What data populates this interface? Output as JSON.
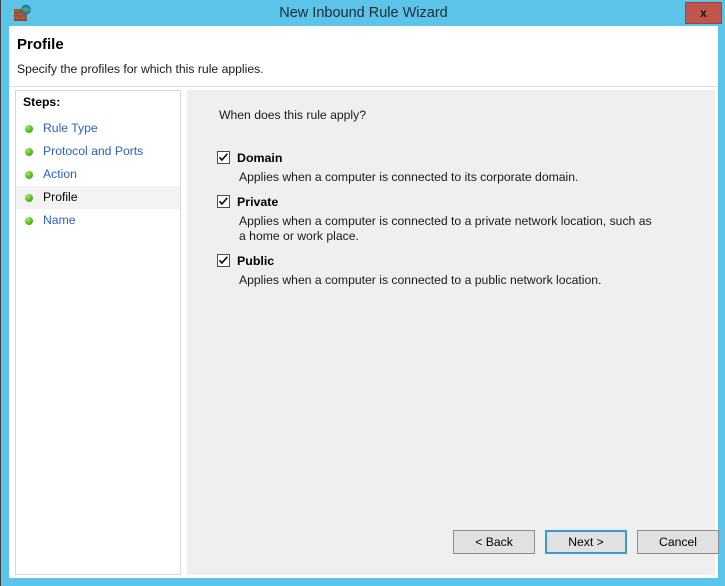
{
  "window": {
    "title": "New Inbound Rule Wizard",
    "icon": "firewall-globe-icon",
    "close_label": "x",
    "accent_color": "#5bc4e8",
    "close_button_color": "#c0554c"
  },
  "header": {
    "title": "Profile",
    "subtitle": "Specify the profiles for which this rule applies."
  },
  "sidebar": {
    "heading": "Steps:",
    "items": [
      {
        "label": "Rule Type",
        "current": false
      },
      {
        "label": "Protocol and Ports",
        "current": false
      },
      {
        "label": "Action",
        "current": false
      },
      {
        "label": "Profile",
        "current": true
      },
      {
        "label": "Name",
        "current": false
      }
    ]
  },
  "main": {
    "question": "When does this rule apply?",
    "profiles": [
      {
        "name": "Domain",
        "checked": true,
        "description": "Applies when a computer is connected to its corporate domain."
      },
      {
        "name": "Private",
        "checked": true,
        "description": "Applies when a computer is connected to a private network location, such as a home or work place."
      },
      {
        "name": "Public",
        "checked": true,
        "description": "Applies when a computer is connected to a public network location."
      }
    ]
  },
  "footer": {
    "back_label": "< Back",
    "next_label": "Next >",
    "cancel_label": "Cancel",
    "default_button": "Next >"
  }
}
